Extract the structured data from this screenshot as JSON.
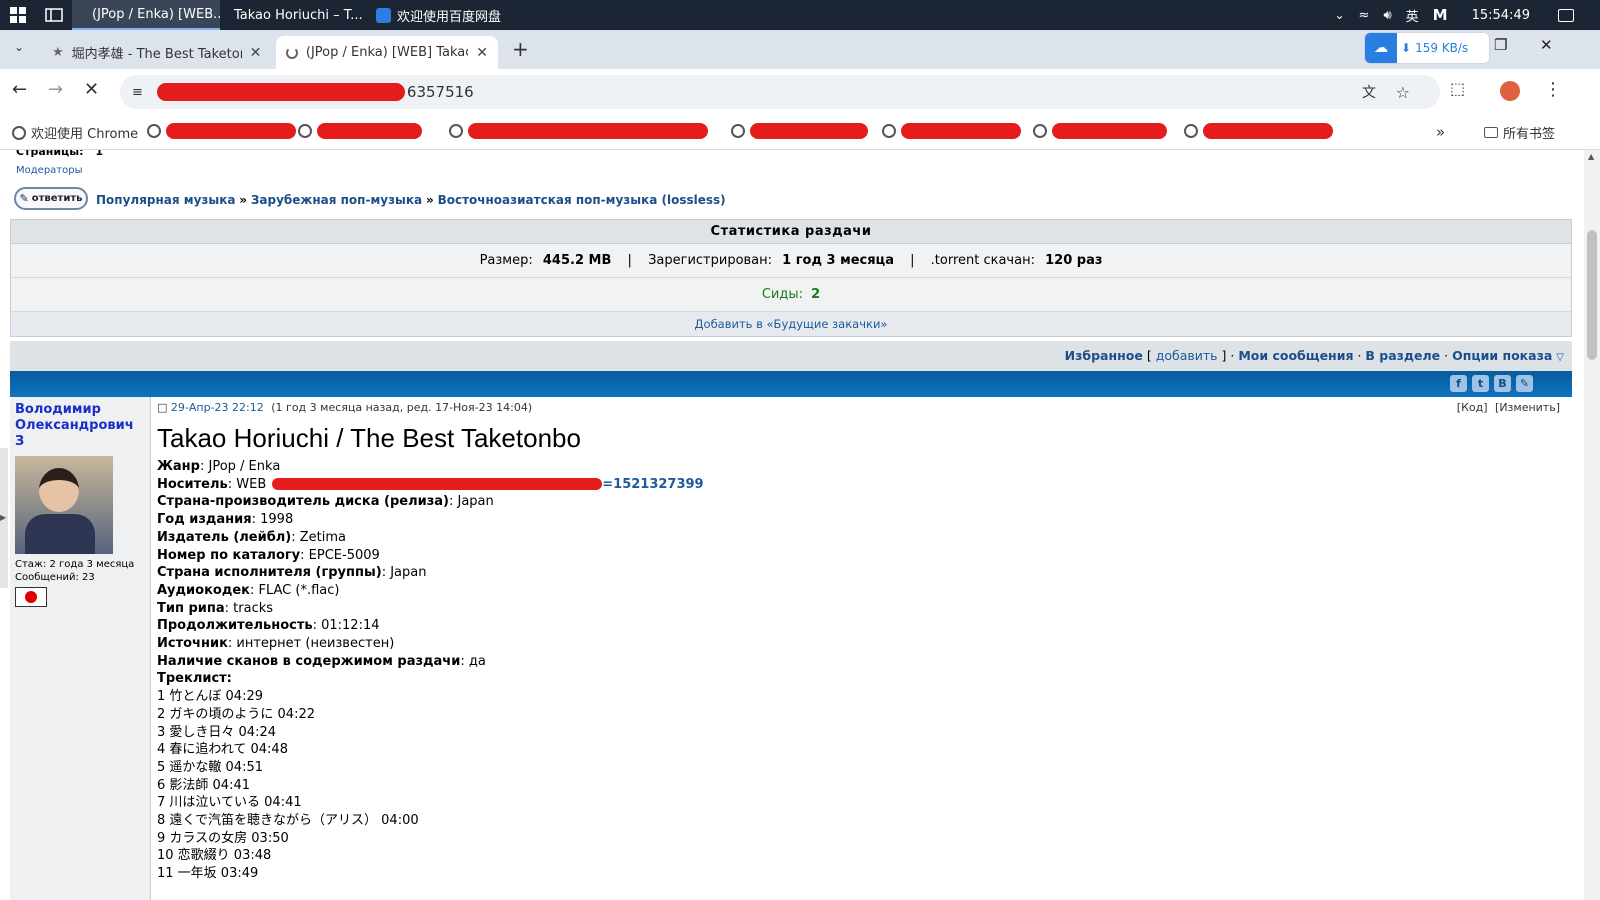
{
  "taskbar": {
    "apps": [
      {
        "label": "(JPop / Enka) [WEB..."
      },
      {
        "label": "Takao Horiuchi – T..."
      },
      {
        "label": "欢迎使用百度网盘"
      }
    ],
    "ime": "英",
    "clock": "15:54:49"
  },
  "tabs": [
    {
      "title": "堀内孝雄 - The Best Taketonb"
    },
    {
      "title": "(JPop / Enka) [WEB] Takao Ho"
    }
  ],
  "download_widget": {
    "speed": "159 KB/s"
  },
  "address": {
    "visible_tail": "6357516"
  },
  "bookmarks": {
    "first": "欢迎使用 Chrome",
    "all_label": "所有书签"
  },
  "forum": {
    "pages_label": "Страницы:",
    "pages_value": "1",
    "moderators": "Модераторы",
    "reply_button": "ответить",
    "breadcrumb": [
      "Популярная музыка",
      "Зарубежная поп-музыка",
      "Восточноазиатская поп-музыка (lossless)"
    ],
    "breadcrumb_sep": "»"
  },
  "stats": {
    "title": "Статистика раздачи",
    "size_label": "Размер:",
    "size_value": "445.2 MB",
    "registered_label": "Зарегистрирован:",
    "registered_value": "1 год 3 месяца",
    "downloaded_label": ".torrent скачан:",
    "downloaded_value": "120 раз",
    "sep": "|",
    "seeds_label": "Сиды:",
    "seeds_value": "2",
    "add_future": "Добавить в «Будущие закачки»"
  },
  "options_bar": {
    "favorites": "Избранное",
    "add": "добавить",
    "my_messages": "Мои сообщения",
    "in_section": "В разделе",
    "display_options": "Опции показа"
  },
  "author": {
    "name": "Володимир Олександрович З",
    "tenure": "Стаж: 2 года 3 месяца",
    "messages": "Сообщений: 23",
    "flag_color": "#e00000"
  },
  "post": {
    "date": "29-Апр-23 22:12",
    "meta": "(1 год 3 месяца назад, ред. 17-Ноя-23 14:04)",
    "code_link": "[Код]",
    "edit_link": "[Изменить]",
    "title": "Takao Horiuchi / The Best Taketonbo",
    "fields": [
      {
        "label": "Жанр",
        "value": "JPop / Enka"
      },
      {
        "label": "Носитель",
        "value": "WEB"
      },
      {
        "label": "Страна-производитель диска (релиза)",
        "value": "Japan"
      },
      {
        "label": "Год издания",
        "value": "1998"
      },
      {
        "label": "Издатель (лейбл)",
        "value": "Zetima"
      },
      {
        "label": "Номер по каталогу",
        "value": "EPCE-5009"
      },
      {
        "label": "Страна исполнителя (группы)",
        "value": "Japan"
      },
      {
        "label": "Аудиокодек",
        "value": "FLAC (*.flac)"
      },
      {
        "label": "Тип рипа",
        "value": "tracks"
      },
      {
        "label": "Продолжительность",
        "value": "01:12:14"
      },
      {
        "label": "Источник",
        "value": "интернет (неизвестен)"
      },
      {
        "label": "Наличие сканов в содержимом раздачи",
        "value": "да"
      }
    ],
    "media_link_tail": "=1521327399",
    "tracklist_label": "Треклист:",
    "tracks": [
      "1 竹とんぼ 04:29",
      "2 ガキの頃のように 04:22",
      "3 愛しき日々 04:24",
      "4 春に追われて 04:48",
      "5 遥かな轍 04:51",
      "6 影法師 04:41",
      "7 川は泣いている 04:41",
      "8 遠くで汽笛を聴きながら（アリス） 04:00",
      "9 カラスの女房 03:50",
      "10 恋歌綴り 03:48",
      "11 一年坂 03:49"
    ]
  }
}
